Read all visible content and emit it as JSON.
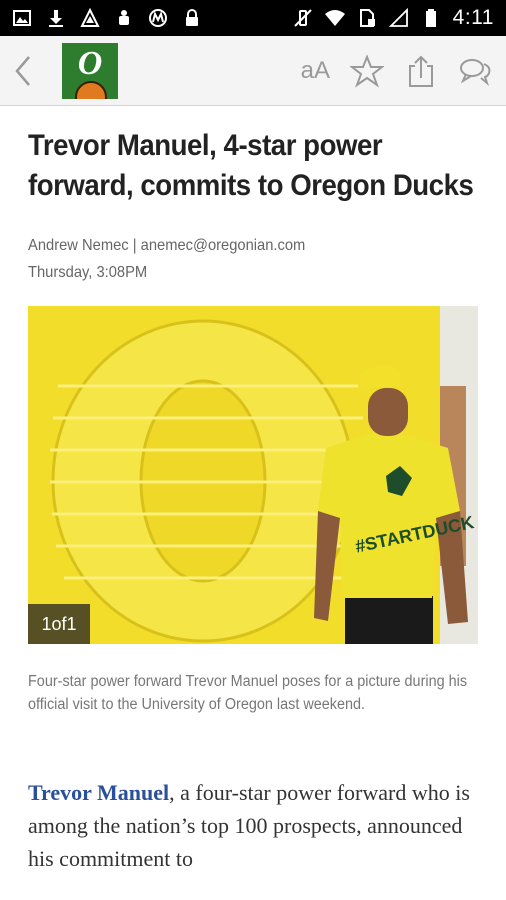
{
  "status_bar": {
    "time": "4:11",
    "left_icons": [
      "image-icon",
      "download-icon",
      "sync-icon",
      "android-icon",
      "motorola-icon",
      "lock-icon"
    ],
    "right_icons": [
      "vibrate-icon",
      "wifi-icon",
      "no-sim-icon",
      "signal-icon",
      "battery-icon"
    ]
  },
  "toolbar": {
    "font_size_label": "aA",
    "icons": [
      "back-icon",
      "logo-icon",
      "star-icon",
      "share-icon",
      "comments-icon"
    ]
  },
  "article": {
    "headline": "Trevor Manuel, 4-star power forward, commits to Oregon Ducks",
    "byline": "Andrew Nemec | anemec@oregonian.com",
    "date": "Thursday, 3:08PM",
    "photo_counter": "1of1",
    "caption": "Four-star power forward Trevor Manuel poses for a picture during his official visit to the University of Oregon last weekend.",
    "body_link": "Trevor Manuel",
    "body_text": ", a four-star power forward who is among the nation’s top 100 prospects, announced his commitment to"
  },
  "colors": {
    "brand_green": "#2e7d2e",
    "link_blue": "#2a4f9c",
    "photo_yellow": "#f0dc28"
  }
}
